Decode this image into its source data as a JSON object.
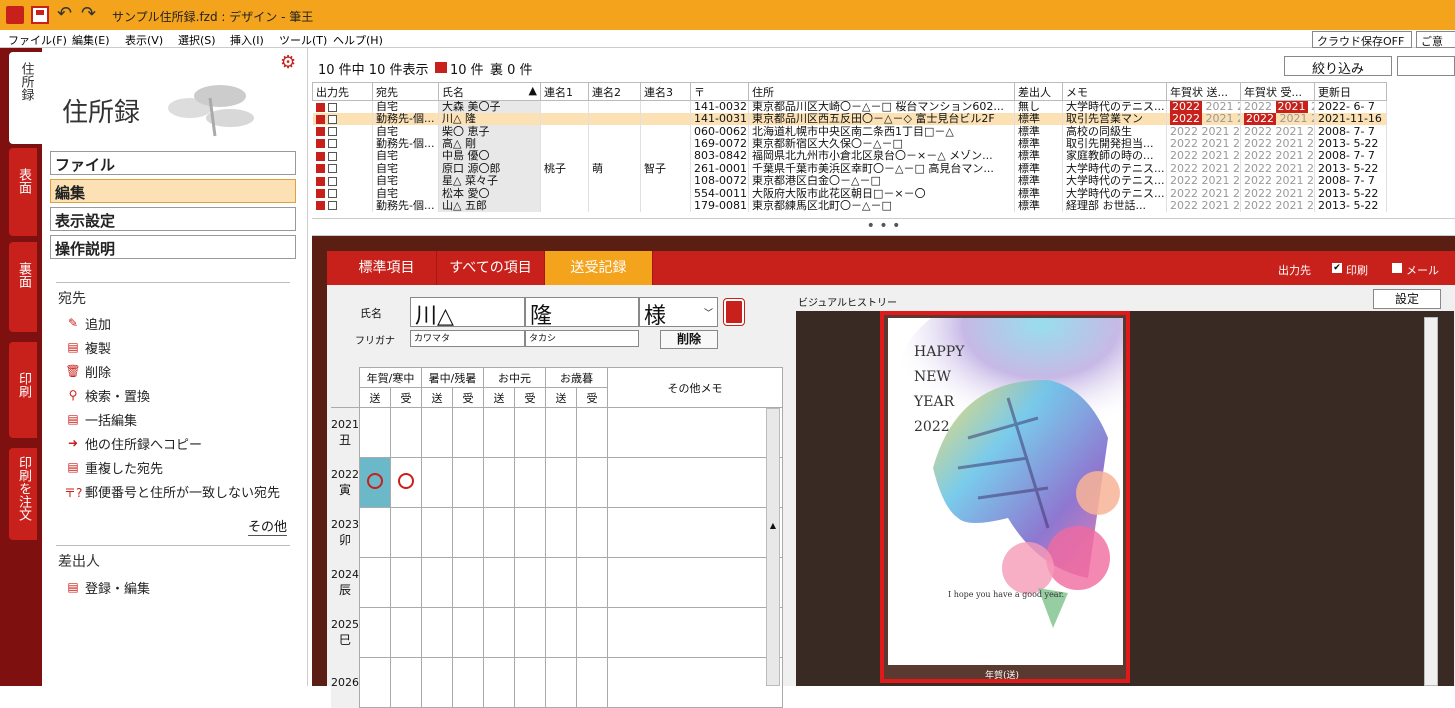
{
  "window": {
    "title": "サンプル住所録.fzd : デザイン - 筆王"
  },
  "menu": [
    "ファイル(F)",
    "編集(E)",
    "表示(V)",
    "選択(S)",
    "挿入(I)",
    "ツール(T)",
    "ヘルプ(H)"
  ],
  "top_buttons": {
    "cloud": "クラウド保存OFF",
    "other": "ご意"
  },
  "side_tabs": [
    {
      "label": "住所録",
      "active": true
    },
    {
      "label": "表面",
      "active": false
    },
    {
      "label": "裏面",
      "active": false
    },
    {
      "label": "印刷",
      "active": false
    },
    {
      "label": "印刷を注文",
      "active": false
    }
  ],
  "left_panel": {
    "title": "住所録",
    "nav": [
      "ファイル",
      "編集",
      "表示設定",
      "操作説明"
    ],
    "nav_active_index": 1,
    "section_atesaki": "宛先",
    "commands": [
      "追加",
      "複製",
      "削除",
      "検索・置換",
      "一括編集",
      "他の住所録へコピー",
      "重複した宛先",
      "郵便番号と住所が一致しない宛先"
    ],
    "more": "その他",
    "section_sashidashi": "差出人",
    "sashidashi_command": "登録・編集"
  },
  "list": {
    "summary": "10 件中 10 件表示",
    "print_count": "10 件",
    "ura_count": "裏 0 件",
    "filter_button": "絞り込み",
    "columns": [
      "出力先",
      "宛先",
      "氏名",
      "連名1",
      "連名2",
      "連名3",
      "〒",
      "住所",
      "差出人",
      "メモ",
      "年賀状 送...",
      "年賀状 受...",
      "更新日"
    ],
    "rows": [
      {
        "ate": "自宅",
        "name": "大森 美〇子",
        "r1": "",
        "r2": "",
        "r3": "",
        "zip": "141-0032",
        "addr": "東京都品川区大崎〇－△－□ 桜台マンション602...",
        "sender": "無し",
        "memo": "大学時代のテニス...",
        "updated": "2022- 6- 7",
        "selected": false
      },
      {
        "ate": "勤務先-個...",
        "name": "川△ 隆",
        "r1": "",
        "r2": "",
        "r3": "",
        "zip": "141-0031",
        "addr": "東京都品川区西五反田〇－△－◇ 富士見台ビル2F",
        "sender": "標準",
        "memo": "取引先営業マン",
        "updated": "2021-11-16",
        "selected": true
      },
      {
        "ate": "自宅",
        "name": "柴〇 恵子",
        "r1": "",
        "r2": "",
        "r3": "",
        "zip": "060-0062",
        "addr": "北海道札幌市中央区南二条西1丁目□－△",
        "sender": "標準",
        "memo": "高校の同級生",
        "updated": "2008- 7- 7",
        "selected": false
      },
      {
        "ate": "勤務先-個...",
        "name": "高△ 剛",
        "r1": "",
        "r2": "",
        "r3": "",
        "zip": "169-0072",
        "addr": "東京都新宿区大久保〇－△－□",
        "sender": "標準",
        "memo": "取引先開発担当...",
        "updated": "2013- 5-22",
        "selected": false
      },
      {
        "ate": "自宅",
        "name": "中島 優〇",
        "r1": "",
        "r2": "",
        "r3": "",
        "zip": "803-0842",
        "addr": "福岡県北九州市小倉北区泉台〇－×－△ メゾン...",
        "sender": "標準",
        "memo": "家庭教師の時の...",
        "updated": "2008- 7- 7",
        "selected": false
      },
      {
        "ate": "自宅",
        "name": "原口 源〇郎",
        "r1": "桃子",
        "r2": "萌",
        "r3": "智子",
        "zip": "261-0001",
        "addr": "千葉県千葉市美浜区幸町〇－△－□ 高見台マン...",
        "sender": "標準",
        "memo": "大学時代のテニス...",
        "updated": "2013- 5-22",
        "selected": false
      },
      {
        "ate": "自宅",
        "name": "星△ 菜々子",
        "r1": "",
        "r2": "",
        "r3": "",
        "zip": "108-0072",
        "addr": "東京都港区白金〇－△－□",
        "sender": "標準",
        "memo": "大学時代のテニス...",
        "updated": "2008- 7- 7",
        "selected": false
      },
      {
        "ate": "自宅",
        "name": "松本 愛〇",
        "r1": "",
        "r2": "",
        "r3": "",
        "zip": "554-0011",
        "addr": "大阪府大阪市此花区朝日□－×－〇",
        "sender": "標準",
        "memo": "大学時代のテニス...",
        "updated": "2013- 5-22",
        "selected": false
      },
      {
        "ate": "勤務先-個...",
        "name": "山△ 五郎",
        "r1": "",
        "r2": "",
        "r3": "",
        "zip": "179-0081",
        "addr": "東京都練馬区北町〇－△－□",
        "sender": "標準",
        "memo": "経理部 お世話...",
        "updated": "2013- 5-22",
        "selected": false
      }
    ],
    "nenga_send": [
      "2022",
      "2021",
      "20"
    ],
    "nenga_recv": [
      "2022",
      "2021",
      "20"
    ]
  },
  "detail": {
    "tabs": [
      "標準項目",
      "すべての項目",
      "送受記録"
    ],
    "active_tab": 2,
    "output_label": "出力先",
    "print_label": "印刷",
    "mail_label": "メール",
    "name_label": "氏名",
    "family_name": "川△",
    "given_name": "隆",
    "honorific": "様",
    "furigana_label": "フリガナ",
    "furigana_family": "カワマタ",
    "furigana_given": "タカシ",
    "delete_button": "削除",
    "history": {
      "groups": [
        "年賀/寒中",
        "暑中/残暑",
        "お中元",
        "お歳暮"
      ],
      "sub": [
        "送",
        "受"
      ],
      "memo_header": "その他メモ",
      "years": [
        {
          "year": "2021",
          "eto": "丑",
          "marks": []
        },
        {
          "year": "2022",
          "eto": "寅",
          "marks": [
            0,
            1
          ]
        },
        {
          "year": "2023",
          "eto": "卯",
          "marks": []
        },
        {
          "year": "2024",
          "eto": "辰",
          "marks": []
        },
        {
          "year": "2025",
          "eto": "巳",
          "marks": []
        },
        {
          "year": "2026",
          "eto": "",
          "marks": []
        }
      ]
    },
    "visual_history_label": "ビジュアルヒストリー",
    "settings_button": "設定",
    "card": {
      "lines": [
        "HAPPY",
        "NEW",
        "YEAR",
        "2022"
      ],
      "message": "I hope you have a good year.",
      "caption": "年賀(送)"
    }
  }
}
